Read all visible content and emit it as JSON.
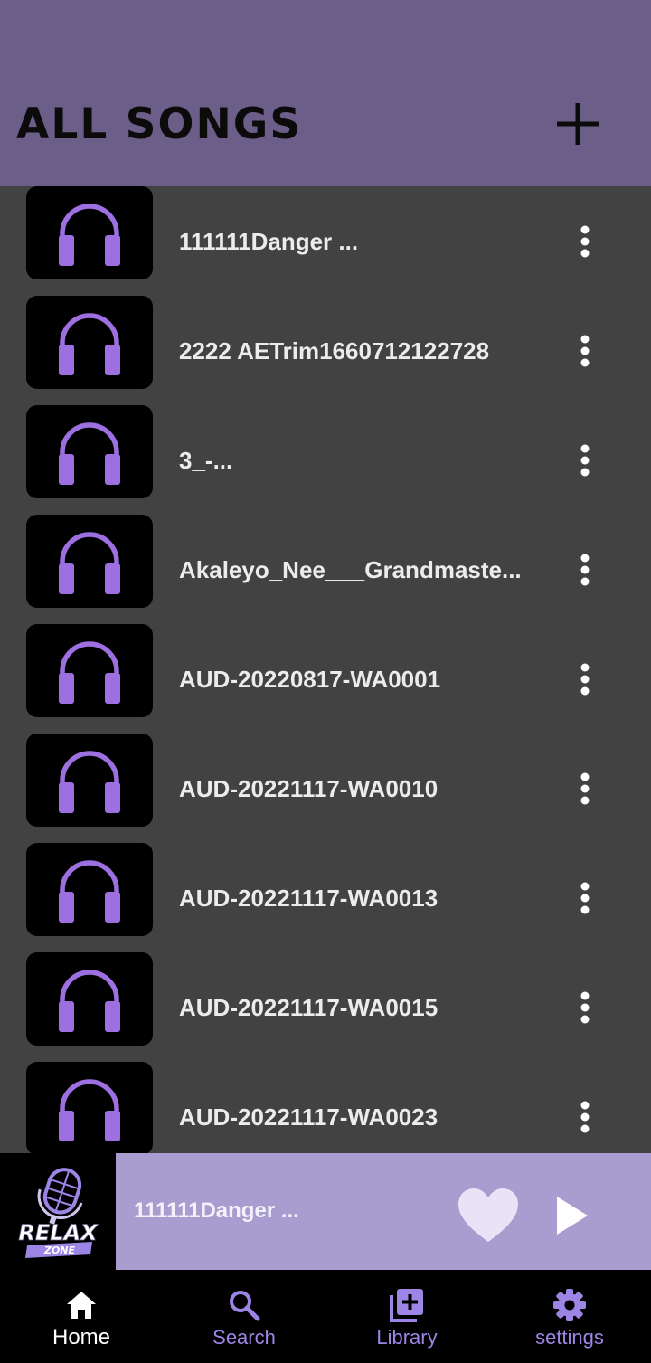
{
  "app_bar": {
    "title": "ALL SONGS",
    "add_icon": "plus-icon"
  },
  "songs": [
    {
      "title": "111111Danger ...",
      "icon": "headphones-icon"
    },
    {
      "title": "2222 AETrim1660712122728",
      "icon": "headphones-icon"
    },
    {
      "title": "3_-...",
      "icon": "headphones-icon"
    },
    {
      "title": "Akaleyo_Nee___Grandmaste...",
      "icon": "headphones-icon"
    },
    {
      "title": "AUD-20220817-WA0001",
      "icon": "headphones-icon"
    },
    {
      "title": "AUD-20221117-WA0010",
      "icon": "headphones-icon"
    },
    {
      "title": "AUD-20221117-WA0013",
      "icon": "headphones-icon"
    },
    {
      "title": "AUD-20221117-WA0015",
      "icon": "headphones-icon"
    },
    {
      "title": "AUD-20221117-WA0023",
      "icon": "headphones-icon"
    }
  ],
  "mini_player": {
    "logo_text": "RELAX",
    "logo_subtext": "ZONE",
    "title": "111111Danger ...",
    "favorite_icon": "heart-icon",
    "play_icon": "play-icon"
  },
  "bottom_nav": [
    {
      "label": "Home",
      "icon": "home-icon",
      "active": true
    },
    {
      "label": "Search",
      "icon": "search-icon",
      "active": false
    },
    {
      "label": "Library",
      "icon": "library-add-icon",
      "active": false
    },
    {
      "label": "settings",
      "icon": "gear-icon",
      "active": false
    }
  ],
  "colors": {
    "app_bar": "#6b5f8a",
    "background": "#424242",
    "accent": "#9d6fe0",
    "mini_player": "#a99ccf",
    "nav_inactive": "#9d85e5"
  }
}
